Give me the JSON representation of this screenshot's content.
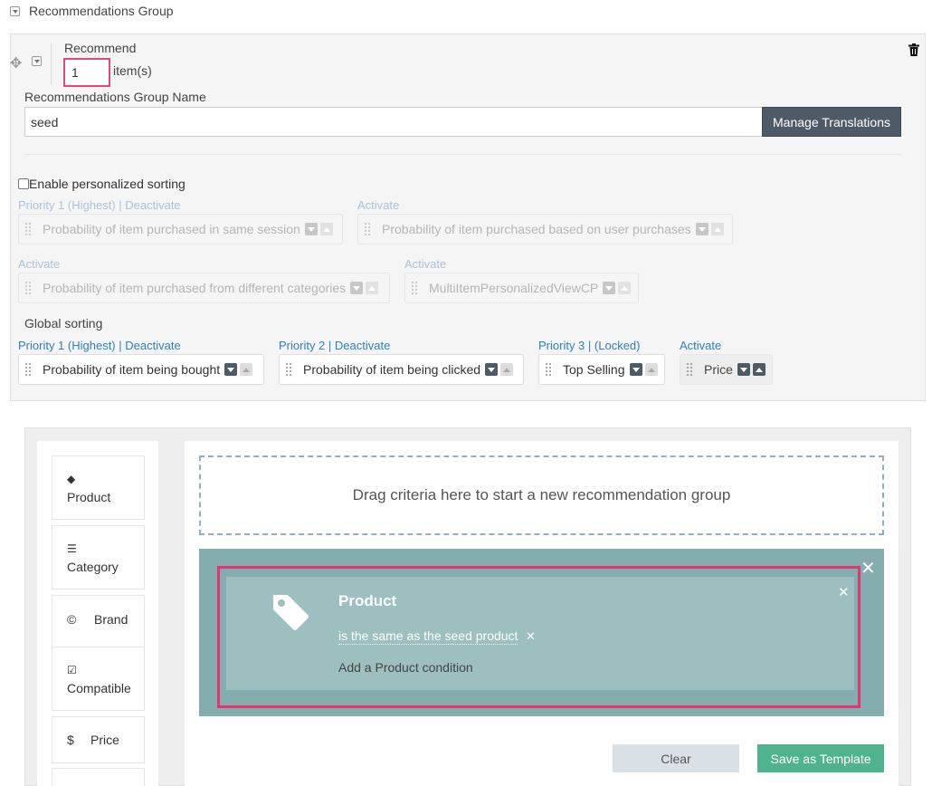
{
  "header": {
    "title": "Recommendations Group"
  },
  "recommend": {
    "label": "Recommend",
    "quantity": "1",
    "unit": "item(s)"
  },
  "group_name": {
    "label": "Recommendations Group Name",
    "value": "seed",
    "manage_label": "Manage Translations"
  },
  "personalized": {
    "checkbox_label": "Enable personalized sorting",
    "checked": false,
    "items": [
      {
        "label": "Priority 1 (Highest) | Deactivate",
        "text": "Probability of item purchased in same session"
      },
      {
        "label": "Activate",
        "text": "Probability of item purchased based on user purchases"
      },
      {
        "label": "Activate",
        "text": "Probability of item purchased from different categories"
      },
      {
        "label": "Activate",
        "text": "MultiItemPersonalizedViewCP"
      }
    ]
  },
  "global_sorting": {
    "title": "Global sorting",
    "items": [
      {
        "label_main": "Priority 1 (Highest)",
        "label_action": "Deactivate",
        "text": "Probability of item being bought"
      },
      {
        "label_main": "Priority 2",
        "label_action": "Deactivate",
        "text": "Probability of item being clicked"
      },
      {
        "label_main": "Priority 3",
        "label_action": "(Locked)",
        "text": "Top Selling"
      },
      {
        "label_main": "",
        "label_action": "Activate",
        "text": "Price"
      }
    ]
  },
  "criteria": [
    {
      "icon": "tag-icon",
      "glyph": "◆",
      "label": "Product"
    },
    {
      "icon": "list-icon",
      "glyph": "☰",
      "label": "Category"
    },
    {
      "icon": "copyright-icon",
      "glyph": "©",
      "label": "Brand"
    },
    {
      "icon": "checkbox-icon",
      "glyph": "☑",
      "label": "Compatible"
    },
    {
      "icon": "dollar-icon",
      "glyph": "$",
      "label": "Price"
    }
  ],
  "builder": {
    "drop_text": "Drag criteria here to start a new recommendation group",
    "card_title": "Product",
    "condition": "is the same as the seed product",
    "add_condition": "Add a Product condition",
    "clear_label": "Clear",
    "save_label": "Save as Template"
  },
  "colors": {
    "highlight": "#e5356f",
    "save": "#4fb38e",
    "group_bg": "#83adaf",
    "link": "#2c7fc0"
  }
}
